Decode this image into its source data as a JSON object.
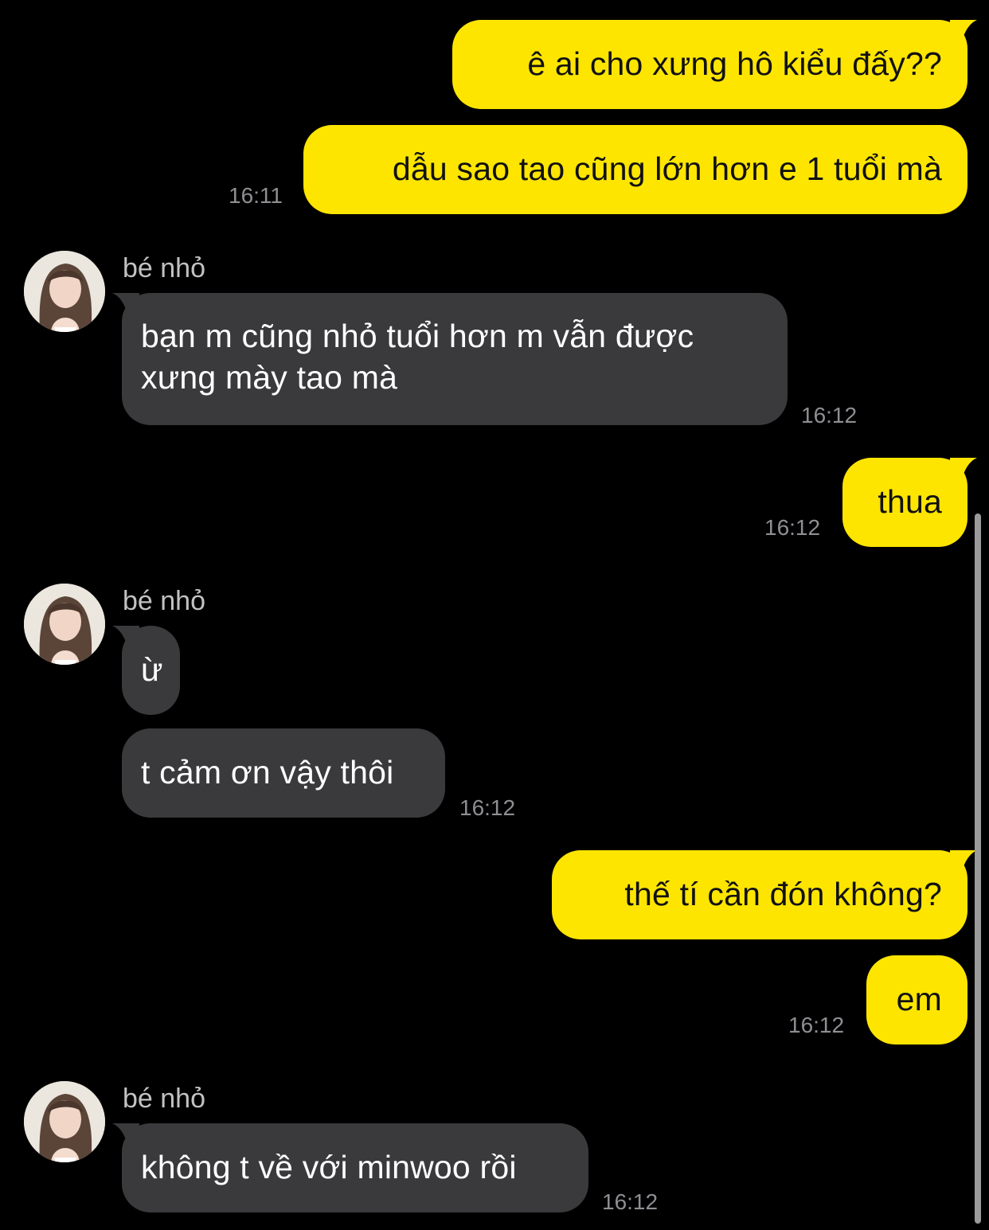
{
  "contact": {
    "name": "bé nhỏ",
    "avatar_icon": "profile-photo-avatar"
  },
  "colors": {
    "background": "#000000",
    "outgoing_bubble": "#FEE500",
    "incoming_bubble": "#3A3A3C",
    "timestamp": "#8E8E93"
  },
  "messages": [
    {
      "direction": "out",
      "text": "ê ai cho xưng hô kiểu đấy??",
      "time": ""
    },
    {
      "direction": "out",
      "text": "dẫu sao tao cũng lớn hơn e 1 tuổi mà",
      "time": "16:11"
    },
    {
      "direction": "in",
      "sender": "bé nhỏ",
      "text_lines": [
        "bạn m cũng nhỏ tuổi hơn m vẫn được",
        "xưng mày tao mà"
      ],
      "time": "16:12"
    },
    {
      "direction": "out",
      "text": "thua",
      "time": "16:12"
    },
    {
      "direction": "in",
      "sender": "bé nhỏ",
      "text": "ừ",
      "time": ""
    },
    {
      "direction": "in",
      "text": "t cảm ơn vậy thôi",
      "time": "16:12"
    },
    {
      "direction": "out",
      "text": "thế tí cần đón không?",
      "time": ""
    },
    {
      "direction": "out",
      "text": "em",
      "time": "16:12"
    },
    {
      "direction": "in",
      "sender": "bé nhỏ",
      "text": "không t về với minwoo rồi",
      "time": "16:12"
    }
  ]
}
